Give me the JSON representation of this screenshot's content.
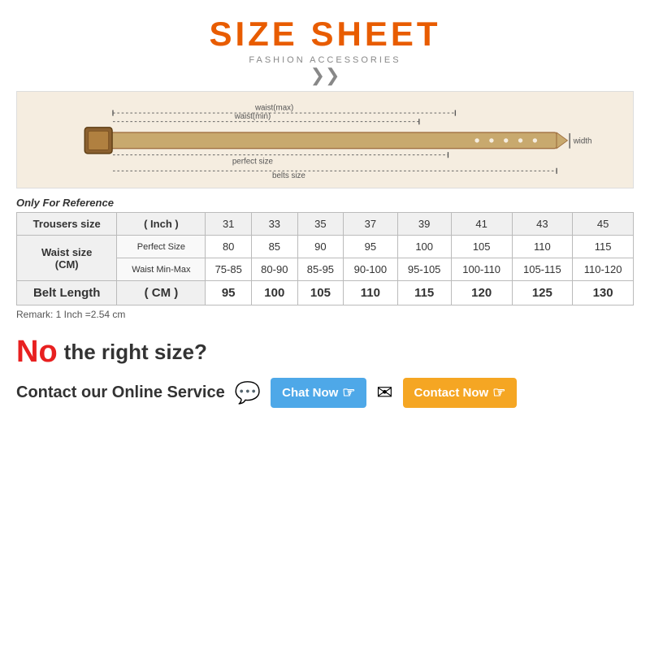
{
  "header": {
    "title": "SIZE SHEET",
    "subtitle": "FASHION ACCESSORIES"
  },
  "only_ref": "Only For Reference",
  "table": {
    "col_headers": [
      "31",
      "33",
      "35",
      "37",
      "39",
      "41",
      "43",
      "45"
    ],
    "row1_label": "Trousers size",
    "row1_unit": "( Inch )",
    "row2_label": "Waist size",
    "row2_unit": "( CM )",
    "row2_sub1": "Perfect Size",
    "row2_sub2": "Waist Min-Max",
    "row3_label": "Belt Length",
    "row3_unit": "( CM )",
    "perfect_sizes": [
      "80",
      "85",
      "90",
      "95",
      "100",
      "105",
      "110",
      "115"
    ],
    "waist_min_max": [
      "75-85",
      "80-90",
      "85-95",
      "90-100",
      "95-105",
      "100-110",
      "105-115",
      "110-120"
    ],
    "belt_lengths": [
      "95",
      "100",
      "105",
      "110",
      "115",
      "120",
      "125",
      "130"
    ]
  },
  "remark": "Remark: 1 Inch =2.54 cm",
  "no_right_size": {
    "no": "No",
    "rest": "the right size?"
  },
  "contact": {
    "label": "Contact our Online Service",
    "chat_now": "Chat Now",
    "contact_now": "Contact Now"
  }
}
